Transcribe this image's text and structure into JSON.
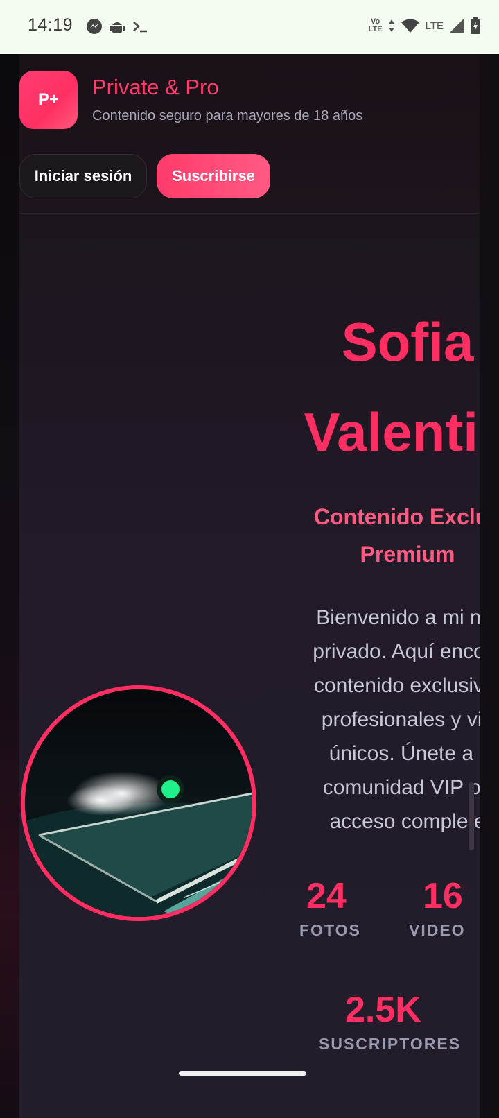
{
  "status_bar": {
    "time": "14:19",
    "network": "LTE",
    "volte_top": "Vo",
    "volte_bottom": "LTE"
  },
  "header": {
    "logo_text": "P+",
    "title": "Private & Pro",
    "subtitle": "Contenido seguro para mayores de 18 años",
    "login_label": "Iniciar sesión",
    "subscribe_label": "Suscribirse"
  },
  "profile": {
    "name_line1": "Sofia",
    "name_line2": "Valentin",
    "tagline": "Contenido Exclus Premium",
    "tagline_line1": "Contenido Exclus",
    "tagline_line2": "Premium",
    "bio_lines": [
      "Bienvenido a mi mu",
      "privado. Aquí encont",
      "contenido exclusivo,",
      "profesionales y vid",
      "únicos. Únete a r",
      "comunidad VIP pa",
      "acceso complete"
    ],
    "stats": [
      {
        "value": "24",
        "label": "FOTOS"
      },
      {
        "value": "16",
        "label": "VIDEO"
      },
      {
        "value": "2.5K",
        "label": "SUSCRIPTORES"
      }
    ]
  },
  "colors": {
    "accent": "#ff2e62",
    "accent_light": "#ff5a82",
    "online": "#1ef08a",
    "background": "#1c151d"
  }
}
